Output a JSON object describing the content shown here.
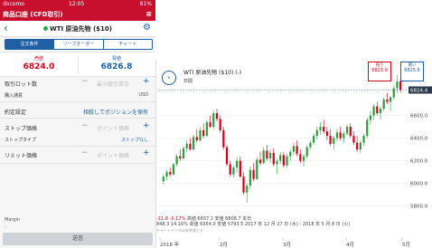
{
  "status": {
    "carrier": "docomo",
    "time": "12:05",
    "battery": "81%"
  },
  "app_header": {
    "title": "商品口座 (CFD取引)",
    "menu": "≡"
  },
  "nav": {
    "back": "‹",
    "title": "WTI 原油先物 ($10)",
    "settings": "⚙"
  },
  "tabs": [
    {
      "label": "注文条件",
      "active": true
    },
    {
      "label": "リーブオーダー",
      "active": false
    },
    {
      "label": "チャート",
      "active": false
    }
  ],
  "quotes": {
    "sell_label": "売値",
    "sell_value": "6824.0",
    "buy_label": "買値",
    "buy_value": "6826.8"
  },
  "form": {
    "quantity_label": "取引ロット数",
    "quantity_placeholder": "最小取引単位",
    "currency_label": "購入通貨",
    "currency_value": "USD",
    "settle_label": "約定設定",
    "settle_value": "相殺してポジションを保有",
    "stop_label": "ストップ価格",
    "stop_placeholder": "ポイント価格",
    "stop_type_label": "ストップタイプ",
    "stop_type_value": "ストップなし",
    "limit_label": "リミット価格",
    "limit_placeholder": "ポイント価格",
    "minus": "−",
    "plus": "+"
  },
  "margin": {
    "label": "Margin",
    "value": "-"
  },
  "send_button": "送信",
  "chart_header": {
    "back": "‹",
    "title": "WTI 原油先物 ($10) (-)",
    "interval": "日間",
    "sell_label": "売り",
    "sell_value": "6823.0",
    "buy_label": "買い",
    "buy_value": "6825.6"
  },
  "chart_footer": {
    "change": "-11.8 -0.17%",
    "open_high": "高値 6837.2  安値 6808.7  本日",
    "range": "848.3 14.16%  高値 6954.0  安値 5793.5  2017 年 12 月 27 日 (水) - 2018 年 5 月 8 日 (火)",
    "note": "チャートデータは参考値です"
  },
  "chart_data": {
    "type": "candlestick",
    "y_ticks": [
      "6600.0",
      "6400.0",
      "6200.0",
      "6000.0",
      "5800.0"
    ],
    "ylim": [
      5750,
      6900
    ],
    "x_ticks": [
      "2018 年",
      "2月",
      "3月",
      "4月",
      "5月"
    ],
    "current_price": "6824.4",
    "colors": {
      "up": "#2e9e3e",
      "down": "#d0021b",
      "last": "#1f5fa6"
    },
    "candles": [
      [
        6020,
        6080,
        5990,
        6060
      ],
      [
        6060,
        6120,
        6030,
        6100
      ],
      [
        6100,
        6140,
        6060,
        6080
      ],
      [
        6080,
        6180,
        6070,
        6170
      ],
      [
        6170,
        6260,
        6150,
        6240
      ],
      [
        6240,
        6300,
        6200,
        6220
      ],
      [
        6220,
        6330,
        6210,
        6310
      ],
      [
        6310,
        6380,
        6280,
        6350
      ],
      [
        6350,
        6400,
        6290,
        6300
      ],
      [
        6300,
        6430,
        6290,
        6410
      ],
      [
        6410,
        6480,
        6360,
        6380
      ],
      [
        6380,
        6500,
        6370,
        6470
      ],
      [
        6470,
        6530,
        6400,
        6420
      ],
      [
        6420,
        6560,
        6410,
        6540
      ],
      [
        6540,
        6600,
        6490,
        6500
      ],
      [
        6500,
        6640,
        6480,
        6620
      ],
      [
        6620,
        6660,
        6550,
        6570
      ],
      [
        6570,
        6600,
        6450,
        6470
      ],
      [
        6470,
        6500,
        6300,
        6320
      ],
      [
        6320,
        6340,
        6150,
        6170
      ],
      [
        6170,
        6200,
        6060,
        6080
      ],
      [
        6080,
        6160,
        6050,
        6140
      ],
      [
        6140,
        6230,
        6100,
        6200
      ],
      [
        6200,
        6240,
        6050,
        6060
      ],
      [
        6060,
        6100,
        5900,
        5920
      ],
      [
        5920,
        6000,
        5830,
        5980
      ],
      [
        5980,
        6150,
        5950,
        6120
      ],
      [
        6120,
        6180,
        6020,
        6040
      ],
      [
        6040,
        6230,
        6030,
        6210
      ],
      [
        6210,
        6280,
        6160,
        6180
      ],
      [
        6180,
        6320,
        6170,
        6290
      ],
      [
        6290,
        6340,
        6200,
        6220
      ],
      [
        6220,
        6300,
        6180,
        6270
      ],
      [
        6270,
        6310,
        6150,
        6170
      ],
      [
        6170,
        6220,
        6080,
        6200
      ],
      [
        6200,
        6280,
        6170,
        6250
      ],
      [
        6250,
        6280,
        6140,
        6160
      ],
      [
        6160,
        6260,
        6140,
        6240
      ],
      [
        6240,
        6300,
        6200,
        6280
      ],
      [
        6280,
        6360,
        6250,
        6330
      ],
      [
        6330,
        6380,
        6240,
        6260
      ],
      [
        6260,
        6300,
        6180,
        6200
      ],
      [
        6200,
        6260,
        6150,
        6240
      ],
      [
        6240,
        6340,
        6220,
        6320
      ],
      [
        6320,
        6380,
        6300,
        6360
      ],
      [
        6360,
        6440,
        6340,
        6420
      ],
      [
        6420,
        6500,
        6390,
        6470
      ],
      [
        6470,
        6540,
        6430,
        6500
      ],
      [
        6500,
        6560,
        6440,
        6460
      ],
      [
        6460,
        6500,
        6380,
        6420
      ],
      [
        6420,
        6480,
        6330,
        6350
      ],
      [
        6350,
        6420,
        6300,
        6400
      ],
      [
        6400,
        6480,
        6370,
        6450
      ],
      [
        6450,
        6500,
        6380,
        6400
      ],
      [
        6400,
        6460,
        6360,
        6440
      ],
      [
        6440,
        6520,
        6420,
        6500
      ],
      [
        6500,
        6530,
        6400,
        6420
      ],
      [
        6420,
        6460,
        6340,
        6360
      ],
      [
        6360,
        6420,
        6280,
        6300
      ],
      [
        6300,
        6380,
        6270,
        6360
      ],
      [
        6360,
        6440,
        6330,
        6420
      ],
      [
        6420,
        6580,
        6400,
        6560
      ],
      [
        6560,
        6640,
        6520,
        6600
      ],
      [
        6600,
        6700,
        6560,
        6680
      ],
      [
        6680,
        6720,
        6600,
        6620
      ],
      [
        6620,
        6680,
        6560,
        6660
      ],
      [
        6660,
        6760,
        6640,
        6740
      ],
      [
        6740,
        6800,
        6700,
        6720
      ],
      [
        6720,
        6770,
        6640,
        6760
      ],
      [
        6760,
        6860,
        6740,
        6840
      ],
      [
        6840,
        6954,
        6800,
        6900
      ],
      [
        6900,
        6920,
        6800,
        6824
      ]
    ]
  }
}
